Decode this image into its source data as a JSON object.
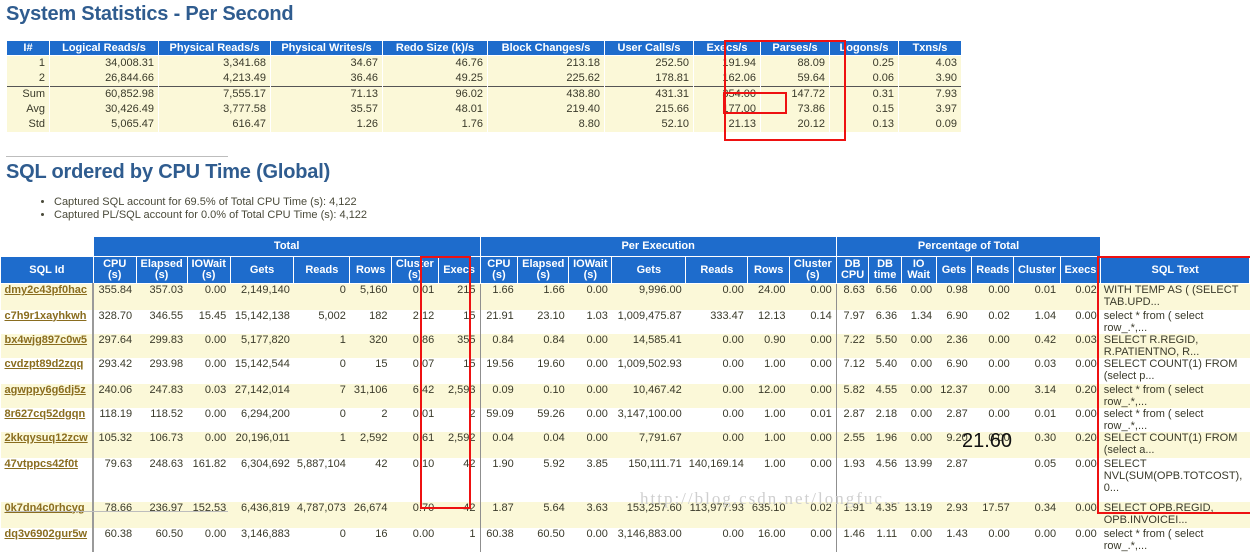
{
  "system_statistics": {
    "title": "System Statistics - Per Second",
    "columns": [
      "I#",
      "Logical Reads/s",
      "Physical Reads/s",
      "Physical Writes/s",
      "Redo Size (k)/s",
      "Block Changes/s",
      "User Calls/s",
      "Execs/s",
      "Parses/s",
      "Logons/s",
      "Txns/s"
    ],
    "rows": [
      [
        "1",
        "34,008.31",
        "3,341.68",
        "34.67",
        "46.76",
        "213.18",
        "252.50",
        "191.94",
        "88.09",
        "0.25",
        "4.03"
      ],
      [
        "2",
        "26,844.66",
        "4,213.49",
        "36.46",
        "49.25",
        "225.62",
        "178.81",
        "162.06",
        "59.64",
        "0.06",
        "3.90"
      ],
      [
        "Sum",
        "60,852.98",
        "7,555.17",
        "71.13",
        "96.02",
        "438.80",
        "431.31",
        "354.00",
        "147.72",
        "0.31",
        "7.93"
      ],
      [
        "Avg",
        "30,426.49",
        "3,777.58",
        "35.57",
        "48.01",
        "219.40",
        "215.66",
        "177.00",
        "73.86",
        "0.15",
        "3.97"
      ],
      [
        "Std",
        "5,065.47",
        "616.47",
        "1.26",
        "1.76",
        "8.80",
        "52.10",
        "21.13",
        "20.12",
        "0.13",
        "0.09"
      ]
    ]
  },
  "sql_section": {
    "title": "SQL ordered by CPU Time (Global)",
    "bullets": [
      "Captured SQL account for 69.5% of Total CPU Time (s): 4,122",
      "Captured PL/SQL account for 0.0% of Total CPU Time (s): 4,122"
    ],
    "group_headers": [
      "Total",
      "Per Execution",
      "Percentage of Total"
    ],
    "columns": {
      "sql_id": "SQL Id",
      "total": [
        "CPU (s)",
        "Elapsed (s)",
        "IOWait (s)",
        "Gets",
        "Reads",
        "Rows",
        "Cluster (s)",
        "Execs"
      ],
      "per_execution": [
        "CPU (s)",
        "Elapsed (s)",
        "IOWait (s)",
        "Gets",
        "Reads",
        "Rows",
        "Cluster (s)"
      ],
      "percentage": [
        "DB CPU",
        "DB time",
        "IO Wait",
        "Gets",
        "Reads",
        "Cluster",
        "Execs"
      ],
      "sql_text": "SQL Text"
    },
    "rows": [
      {
        "sql_id": "dmy2c43pf0hac",
        "total": [
          "355.84",
          "357.03",
          "0.00",
          "2,149,140",
          "0",
          "5,160",
          "0.01",
          "215"
        ],
        "per_execution": [
          "1.66",
          "1.66",
          "0.00",
          "9,996.00",
          "0.00",
          "24.00",
          "0.00"
        ],
        "percentage": [
          "8.63",
          "6.56",
          "0.00",
          "0.98",
          "0.00",
          "0.01",
          "0.02"
        ],
        "sql_text": "WITH TEMP AS ( (SELECT TAB.UPD..."
      },
      {
        "sql_id": "c7h9r1xayhkwh",
        "total": [
          "328.70",
          "346.55",
          "15.45",
          "15,142,138",
          "5,002",
          "182",
          "2.12",
          "15"
        ],
        "per_execution": [
          "21.91",
          "23.10",
          "1.03",
          "1,009,475.87",
          "333.47",
          "12.13",
          "0.14"
        ],
        "percentage": [
          "7.97",
          "6.36",
          "1.34",
          "6.90",
          "0.02",
          "1.04",
          "0.00"
        ],
        "sql_text": "select * from ( select row_.*,..."
      },
      {
        "sql_id": "bx4wjg897c0w5",
        "total": [
          "297.64",
          "299.83",
          "0.00",
          "5,177,820",
          "1",
          "320",
          "0.86",
          "355"
        ],
        "per_execution": [
          "0.84",
          "0.84",
          "0.00",
          "14,585.41",
          "0.00",
          "0.90",
          "0.00"
        ],
        "percentage": [
          "7.22",
          "5.50",
          "0.00",
          "2.36",
          "0.00",
          "0.42",
          "0.03"
        ],
        "sql_text": "SELECT R.REGID, R.PATIENTNO, R..."
      },
      {
        "sql_id": "cvdzpt89d2zqq",
        "total": [
          "293.42",
          "293.98",
          "0.00",
          "15,142,544",
          "0",
          "15",
          "0.07",
          "15"
        ],
        "per_execution": [
          "19.56",
          "19.60",
          "0.00",
          "1,009,502.93",
          "0.00",
          "1.00",
          "0.00"
        ],
        "percentage": [
          "7.12",
          "5.40",
          "0.00",
          "6.90",
          "0.00",
          "0.03",
          "0.00"
        ],
        "sql_text": "SELECT COUNT(1) FROM (select p..."
      },
      {
        "sql_id": "agwppy6g6dj5z",
        "total": [
          "240.06",
          "247.83",
          "0.03",
          "27,142,014",
          "7",
          "31,106",
          "6.42",
          "2,593"
        ],
        "per_execution": [
          "0.09",
          "0.10",
          "0.00",
          "10,467.42",
          "0.00",
          "12.00",
          "0.00"
        ],
        "percentage": [
          "5.82",
          "4.55",
          "0.00",
          "12.37",
          "0.00",
          "3.14",
          "0.20"
        ],
        "sql_text": "select * from ( select row_.*,..."
      },
      {
        "sql_id": "8r627cq52dgqn",
        "total": [
          "118.19",
          "118.52",
          "0.00",
          "6,294,200",
          "0",
          "2",
          "0.01",
          "2"
        ],
        "per_execution": [
          "59.09",
          "59.26",
          "0.00",
          "3,147,100.00",
          "0.00",
          "1.00",
          "0.01"
        ],
        "percentage": [
          "2.87",
          "2.18",
          "0.00",
          "2.87",
          "0.00",
          "0.01",
          "0.00"
        ],
        "sql_text": "select * from ( select row_.*,..."
      },
      {
        "sql_id": "2kkqysuq12zcw",
        "total": [
          "105.32",
          "106.73",
          "0.00",
          "20,196,011",
          "1",
          "2,592",
          "0.61",
          "2,592"
        ],
        "per_execution": [
          "0.04",
          "0.04",
          "0.00",
          "7,791.67",
          "0.00",
          "1.00",
          "0.00"
        ],
        "percentage": [
          "2.55",
          "1.96",
          "0.00",
          "9.20",
          "0.00",
          "0.30",
          "0.20"
        ],
        "sql_text": "SELECT COUNT(1) FROM (select a..."
      },
      {
        "sql_id": "47vtppcs42f0t",
        "total": [
          "79.63",
          "248.63",
          "161.82",
          "6,304,692",
          "5,887,104",
          "42",
          "0.10",
          "42"
        ],
        "per_execution": [
          "1.90",
          "5.92",
          "3.85",
          "150,111.71",
          "140,169.14",
          "1.00",
          "0.00"
        ],
        "percentage": [
          "1.93",
          "4.56",
          "13.99",
          "2.87",
          "",
          "0.05",
          "0.00"
        ],
        "sql_text": "SELECT NVL(SUM(OPB.TOTCOST), 0..."
      },
      {
        "sql_id": "0k7dn4c0rhcyg",
        "total": [
          "78.66",
          "236.97",
          "152.53",
          "6,436,819",
          "4,787,073",
          "26,674",
          "0.70",
          "42"
        ],
        "per_execution": [
          "1.87",
          "5.64",
          "3.63",
          "153,257.60",
          "113,977.93",
          "635.10",
          "0.02"
        ],
        "percentage": [
          "1.91",
          "4.35",
          "13.19",
          "2.93",
          "17.57",
          "0.34",
          "0.00"
        ],
        "sql_text": "SELECT OPB.REGID, OPB.INVOICEI..."
      },
      {
        "sql_id": "dq3v6902gur5w",
        "total": [
          "60.38",
          "60.50",
          "0.00",
          "3,146,883",
          "0",
          "16",
          "0.00",
          "1"
        ],
        "per_execution": [
          "60.38",
          "60.50",
          "0.00",
          "3,146,883.00",
          "0.00",
          "16.00",
          "0.00"
        ],
        "percentage": [
          "1.46",
          "1.11",
          "0.00",
          "1.43",
          "0.00",
          "0.00",
          "0.00"
        ],
        "sql_text": "select * from ( select row_.*,..."
      }
    ]
  },
  "annotations": {
    "value_2160": "21.60",
    "highlight_color": "#ee1111",
    "header_color": "#1e6ccc",
    "row_color": "#fbf8d8"
  },
  "watermark": "http://blog.csdn.net/longfuc..."
}
